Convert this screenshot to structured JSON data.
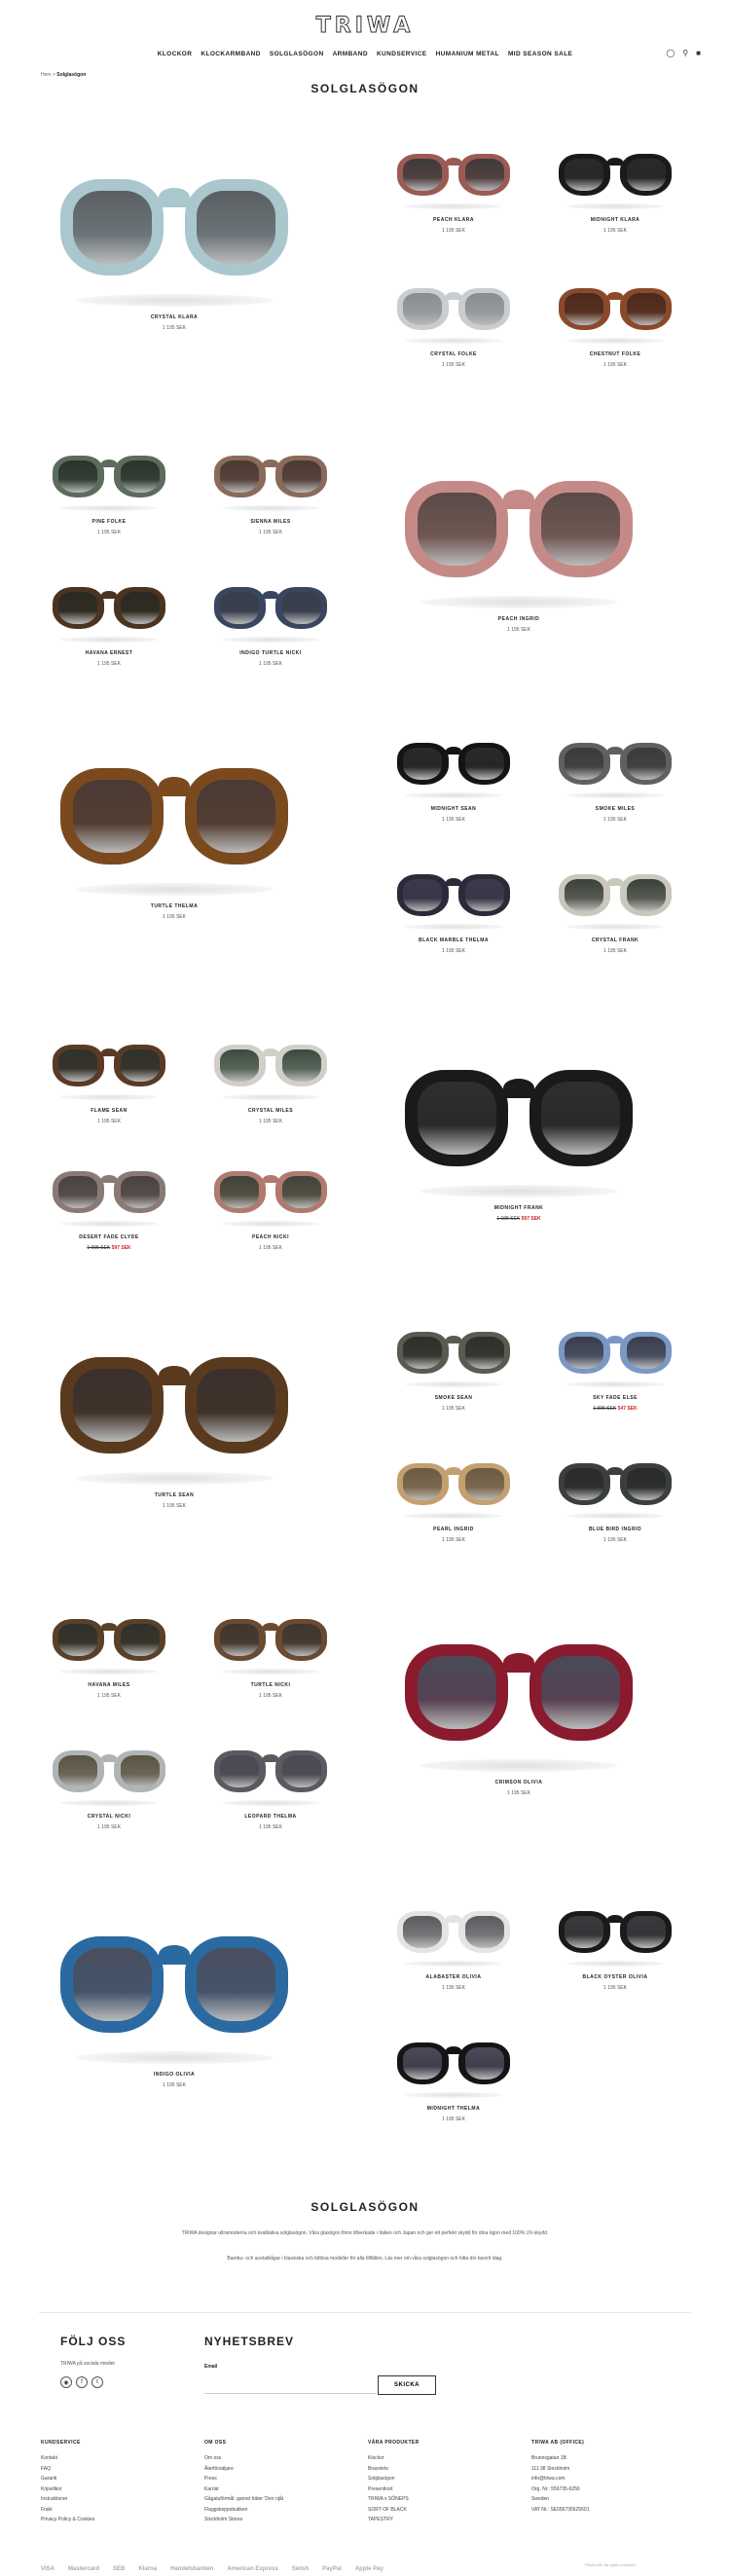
{
  "brand": "TRIWA",
  "nav": {
    "items": [
      "KLOCKOR",
      "KLOCKARMBAND",
      "SOLGLASÖGON",
      "ARMBAND",
      "KUNDSERVICE",
      "HUMANIUM METAL",
      "MID SEASON SALE"
    ]
  },
  "icons": {
    "globe": "globe-icon",
    "search": "search-icon",
    "cart": "bag-icon"
  },
  "breadcrumb": {
    "home": "Hem",
    "separator": ">",
    "current": "Solglasögon"
  },
  "page_title": "SOLGLASÖGON",
  "products": [
    {
      "name": "CRYSTAL KLARA",
      "price": "1 195 SEK",
      "frame": "#a9c7cc",
      "lens": "#5b5f63"
    },
    {
      "name": "PEACH KLARA",
      "price": "1 195 SEK",
      "frame": "#9b5a54",
      "lens": "#3f3a3b"
    },
    {
      "name": "MIDNIGHT KLARA",
      "price": "1 195 SEK",
      "frame": "#1a1a1a",
      "lens": "#2a2a2a"
    },
    {
      "name": "CRYSTAL FOLKE",
      "price": "1 195 SEK",
      "frame": "#c9cdd0",
      "lens": "#8a8d90"
    },
    {
      "name": "CHESTNUT FOLKE",
      "price": "1 195 SEK",
      "frame": "#8a4a2a",
      "lens": "#4a2a1e"
    },
    {
      "name": "PINE FOLKE",
      "price": "1 195 SEK",
      "frame": "#5b6b5c",
      "lens": "#2b332b"
    },
    {
      "name": "SIENNA MILES",
      "price": "1 195 SEK",
      "frame": "#8a6a5a",
      "lens": "#4a3a33"
    },
    {
      "name": "PEACH INGRID",
      "price": "1 195 SEK",
      "frame": "#c58a88",
      "lens": "#5a4a46"
    },
    {
      "name": "HAVANA ERNEST",
      "price": "1 195 SEK",
      "frame": "#4a3420",
      "lens": "#2a2a22"
    },
    {
      "name": "INDIGO TURTLE NICKI",
      "price": "1 195 SEK",
      "frame": "#3a4560",
      "lens": "#3a3e4a"
    },
    {
      "name": "TURTLE THELMA",
      "price": "1 195 SEK",
      "frame": "#7a4a1e",
      "lens": "#4a3a36"
    },
    {
      "name": "MIDNIGHT SEAN",
      "price": "1 195 SEK",
      "frame": "#141414",
      "lens": "#2a2a2a"
    },
    {
      "name": "SMOKE MILES",
      "price": "1 195 SEK",
      "frame": "#606060",
      "lens": "#3a3a3a"
    },
    {
      "name": "BLACK MARBLE THELMA",
      "price": "1 195 SEK",
      "frame": "#2a2a3a",
      "lens": "#3a3a4a"
    },
    {
      "name": "CRYSTAL FRANK",
      "price": "1 195 SEK",
      "frame": "#c8c8bc",
      "lens": "#3a4038"
    },
    {
      "name": "FLAME SEAN",
      "price": "1 195 SEK",
      "frame": "#5a3a26",
      "lens": "#2e322c"
    },
    {
      "name": "CRYSTAL MILES",
      "price": "1 195 SEK",
      "frame": "#d0d0c8",
      "lens": "#3a4a3e"
    },
    {
      "name": "MIDNIGHT FRANK",
      "price_old": "1 195 SEK",
      "price_sale": "597 SEK",
      "frame": "#1a1a1a",
      "lens": "#2e2e2e"
    },
    {
      "name": "DESERT FADE CLYDE",
      "price_old": "1 095 SEK",
      "price_sale": "597 SEK",
      "frame": "#8a7a76",
      "lens": "#4a4240"
    },
    {
      "name": "PEACH NICKI",
      "price": "1 195 SEK",
      "frame": "#b07a6e",
      "lens": "#3e4438"
    },
    {
      "name": "TURTLE SEAN",
      "price": "1 195 SEK",
      "frame": "#5a3a1e",
      "lens": "#3a302c"
    },
    {
      "name": "SMOKE SEAN",
      "price": "1 195 SEK",
      "frame": "#5a5a50",
      "lens": "#2e2e2a"
    },
    {
      "name": "SKY FADE ELSE",
      "price_old": "1 095 SEK",
      "price_sale": "547 SEK",
      "frame": "#7a98c4",
      "lens": "#3a3c48"
    },
    {
      "name": "PEARL INGRID",
      "price": "1 195 SEK",
      "frame": "#c4a070",
      "lens": "#6a5a44"
    },
    {
      "name": "BLUE BIRD INGRID",
      "price": "1 195 SEK",
      "frame": "#3a3e3e",
      "lens": "#2a2a2a"
    },
    {
      "name": "HAVANA MILES",
      "price": "1 195 SEK",
      "frame": "#5a4028",
      "lens": "#2e322a"
    },
    {
      "name": "TURTLE NICKI",
      "price": "1 195 SEK",
      "frame": "#6a4a30",
      "lens": "#3e3632"
    },
    {
      "name": "CRIMSON OLIVIA",
      "price": "1 195 SEK",
      "frame": "#8a1a2e",
      "lens": "#4a4a5a"
    },
    {
      "name": "CRYSTAL NICKI",
      "price": "1 195 SEK",
      "frame": "#b0b4b4",
      "lens": "#5a5240"
    },
    {
      "name": "LEOPARD THELMA",
      "price": "1 195 SEK",
      "frame": "#5a5a60",
      "lens": "#4a4a52"
    },
    {
      "name": "INDIGO OLIVIA",
      "price": "1 195 SEK",
      "frame": "#2a6aa0",
      "lens": "#4a4e5e"
    },
    {
      "name": "ALABASTER OLIVIA",
      "price": "1 195 SEK",
      "frame": "#e4e4e2",
      "lens": "#5a5a5e"
    },
    {
      "name": "BLACK OYSTER OLIVIA",
      "price": "1 195 SEK",
      "frame": "#1a1a1a",
      "lens": "#3a3a3e"
    },
    {
      "name": "MIDNIGHT THELMA",
      "price": "1 195 SEK",
      "frame": "#141414",
      "lens": "#4a4a5a"
    }
  ],
  "seo": {
    "title": "SOLGLASÖGON",
    "p1": "TRIWA designar ultramoderna och kvalitativa solglasögon. Våra glasögon finns tillverkade i Italien och Japan och ger ett perfekt skydd för dina ögon med 100% UV-skydd.",
    "p2": "Bambu- och acetatbågar i klassiska och tidlösa modeller för alla tillfällen. Läs mer om våra solglasögon och hitta din favorit idag."
  },
  "follow": {
    "title": "FÖLJ OSS",
    "subtitle": "TRIWA på sociala medier"
  },
  "newsletter": {
    "title": "NYHETSBREV",
    "label": "Email",
    "placeholder": "",
    "button": "SKICKA"
  },
  "footer": {
    "col1": {
      "title": "KUNDSERVICE",
      "links": [
        "Kontakt",
        "FAQ",
        "Garanti",
        "Köpvillkor",
        "Instruktioner",
        "Frakt",
        "Privacy Policy & Cookies"
      ]
    },
    "col2": {
      "title": "OM OSS",
      "links": [
        "Om oss",
        "Återförsäljare",
        "Press",
        "Karriär",
        "Gågatuförmål: garnet häter 'Den njåt",
        "Flaggskeppsbutiken",
        "Stockholm Stores"
      ]
    },
    "col3": {
      "title": "VÅRA PRODUKTER",
      "links": [
        "Klockor",
        "Bracelets",
        "Solglasögon",
        "Presentkort",
        "TRIWA x SÖNEPS",
        "SORT OF BLACK",
        "TAPESTRY"
      ]
    },
    "col4": {
      "title": "TRIWA AB (OFFICE)",
      "lines": [
        "Brunnsgatan 1B",
        "111 38 Stockholm",
        "info@triwa.com",
        "Org. Nr.: 556735-6256",
        "Sweden",
        "VAT Nr.: SE556735625601"
      ]
    }
  },
  "payments": [
    "VISA",
    "Mastercard",
    "SEB",
    "Klarna",
    "Handelsbanken",
    "American Express",
    "Swish",
    "PayPal",
    "Apple Pay"
  ],
  "copyright": "TRIWA AB. All rights reserved."
}
